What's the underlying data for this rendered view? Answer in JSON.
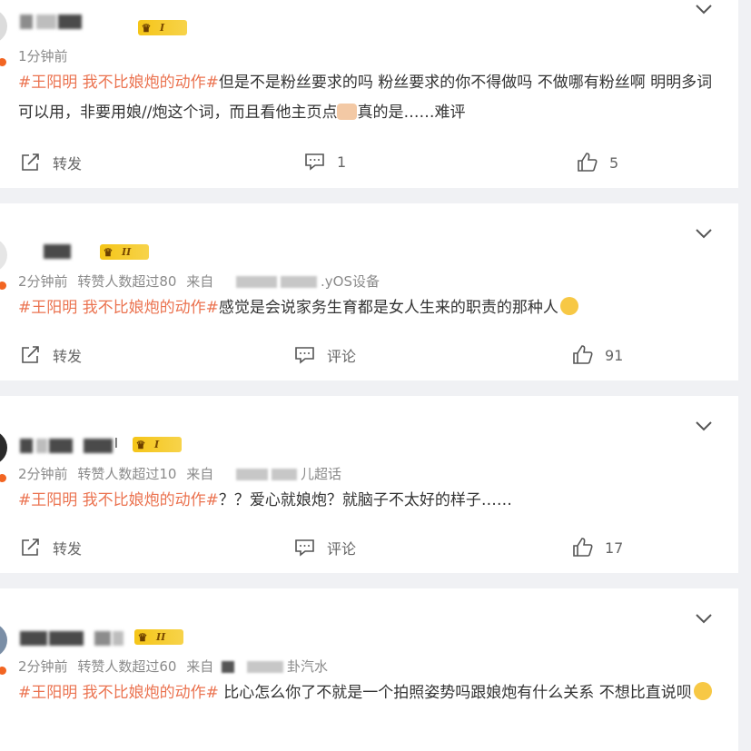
{
  "comments": [
    {
      "level": "I",
      "time": "1分钟前",
      "meta_extra": [],
      "hashtag": "#王阳明 我不比娘炮的动作#",
      "text_parts": [
        "但是不是粉丝要求的吗 粉丝要求的你不得做吗 不做哪有粉丝啊 明明多词可以用，非要用娘//炮这个词，而且看他主页点",
        "真的是……难评"
      ],
      "repost_label": "转发",
      "comment_label": "1",
      "like_count": "5"
    },
    {
      "level": "II",
      "time": "2分钟前",
      "meta_extra": [
        "转赞人数超过80",
        "来自"
      ],
      "source_suffix": ".yOS设备",
      "hashtag": "#王阳明 我不比娘炮的动作#",
      "text_parts": [
        "感觉是会说家务生育都是女人生来的职责的那种人"
      ],
      "repost_label": "转发",
      "comment_label": "评论",
      "like_count": "91"
    },
    {
      "level": "I",
      "name_suffix": "l",
      "time": "2分钟前",
      "meta_extra": [
        "转赞人数超过10",
        "来自"
      ],
      "source_suffix": "儿超话",
      "hashtag": "#王阳明 我不比娘炮的动作#",
      "text_parts": "？？爱心就娘炮？就脑子不太好的样子……",
      "repost_label": "转发",
      "comment_label": "评论",
      "like_count": "17"
    },
    {
      "level": "II",
      "time": "2分钟前",
      "meta_extra": [
        "转赞人数超过60",
        "来自"
      ],
      "source_suffix": "卦汽水",
      "hashtag": "#王阳明 我不比娘炮的动作#",
      "text_parts": [
        " 比心怎么你了不就是一个拍照姿势吗跟娘炮有什么关系 不想比直说呗"
      ]
    }
  ],
  "icons": {
    "chevron": "chevron-down-icon",
    "repost": "repost-icon",
    "comment": "comment-icon",
    "like": "like-icon",
    "crown": "crown-icon"
  },
  "colors": {
    "hashtag": "#eb7350",
    "crown": "#f5c518",
    "background": "#f0f1f4"
  }
}
